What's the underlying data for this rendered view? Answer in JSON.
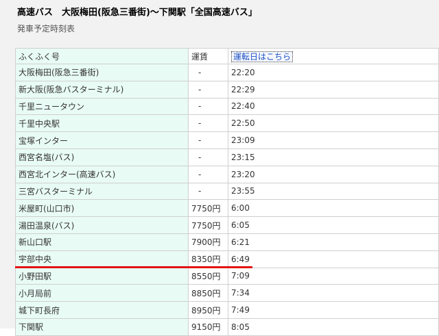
{
  "header": {
    "title": "高速バス　大阪梅田(阪急三番街)〜下関駅「全国高速バス」",
    "subtitle": "発車予定時刻表"
  },
  "table": {
    "col_stop": "ふくふく号",
    "col_fare": "運賃",
    "col_link": "運転日はこちら",
    "rows": [
      {
        "stop": "大阪梅田(阪急三番街)",
        "fare": "-",
        "time": "22:20"
      },
      {
        "stop": "新大阪(阪急バスターミナル)",
        "fare": "-",
        "time": "22:29"
      },
      {
        "stop": "千里ニュータウン",
        "fare": "-",
        "time": "22:40"
      },
      {
        "stop": "千里中央駅",
        "fare": "-",
        "time": "22:50"
      },
      {
        "stop": "宝塚インター",
        "fare": "-",
        "time": "23:09"
      },
      {
        "stop": "西宮名塩(バス)",
        "fare": "-",
        "time": "23:15"
      },
      {
        "stop": "西宮北インター(高速バス)",
        "fare": "-",
        "time": "23:20"
      },
      {
        "stop": "三宮バスターミナル",
        "fare": "-",
        "time": "23:55"
      },
      {
        "stop": "米屋町(山口市)",
        "fare": "7750円",
        "time": "6:00"
      },
      {
        "stop": "湯田温泉(バス)",
        "fare": "7750円",
        "time": "6:05"
      },
      {
        "stop": "新山口駅",
        "fare": "7900円",
        "time": "6:21"
      },
      {
        "stop": "宇部中央",
        "fare": "8350円",
        "time": "6:49"
      },
      {
        "stop": "小野田駅",
        "fare": "8550円",
        "time": "7:09"
      },
      {
        "stop": "小月局前",
        "fare": "8850円",
        "time": "7:34"
      },
      {
        "stop": "城下町長府",
        "fare": "8950円",
        "time": "7:49"
      },
      {
        "stop": "下関駅",
        "fare": "9150円",
        "time": "8:05"
      }
    ]
  },
  "annotation": {
    "underline_color": "#e31212",
    "underlined_stop": "宇部中央"
  }
}
